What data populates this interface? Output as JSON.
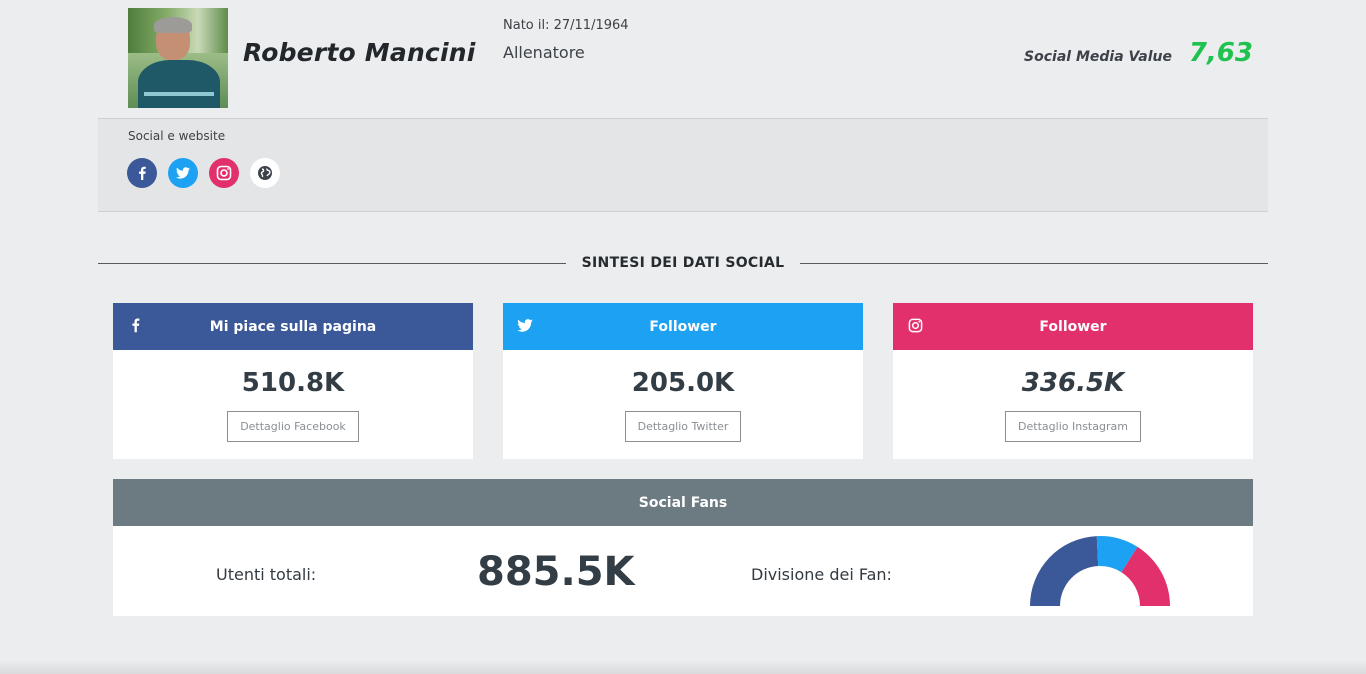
{
  "profile": {
    "name": "Roberto Mancini",
    "born": "Nato il: 27/11/1964",
    "role": "Allenatore",
    "smv_label": "Social Media Value",
    "smv_value": "7,63"
  },
  "social": {
    "title": "Social e website",
    "icons": [
      "facebook-icon",
      "twitter-icon",
      "instagram-icon",
      "globe-icon"
    ]
  },
  "section_title": "SINTESI DEI DATI SOCIAL",
  "cards": {
    "facebook": {
      "title": "Mi piace sulla pagina",
      "value": "510.8K",
      "button": "Dettaglio Facebook",
      "color": "#3b5998"
    },
    "twitter": {
      "title": "Follower",
      "value": "205.0K",
      "button": "Dettaglio Twitter",
      "color": "#1da1f2"
    },
    "instagram": {
      "title": "Follower",
      "value": "336.5K",
      "button": "Dettaglio Instagram",
      "color": "#e1306c"
    }
  },
  "fans": {
    "title": "Social Fans",
    "total_label": "Utenti totali:",
    "total_value": "885.5K",
    "division_label": "Divisione dei Fan:",
    "division": [
      {
        "network": "facebook",
        "value": 510.8,
        "color": "#3b5998"
      },
      {
        "network": "twitter",
        "value": 205.0,
        "color": "#1da1f2"
      },
      {
        "network": "instagram",
        "value": 336.5,
        "color": "#e1306c"
      }
    ]
  },
  "colors": {
    "smv": "#1fc24f",
    "fans_header": "#6c7a82"
  }
}
